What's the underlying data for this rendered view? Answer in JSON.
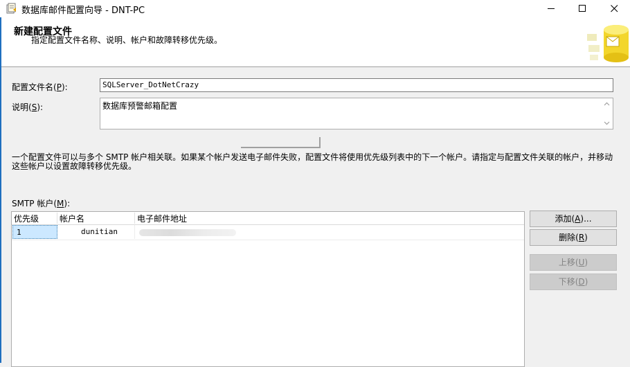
{
  "window": {
    "title": "数据库邮件配置向导 - DNT-PC",
    "minimize_icon": "minimize-icon",
    "maximize_icon": "maximize-icon",
    "close_icon": "close-icon"
  },
  "header": {
    "title": "新建配置文件",
    "subtitle": "指定配置文件名称、说明、帐户和故障转移优先级。",
    "image": "database-mail-icon"
  },
  "form": {
    "profile_name_label_pre": "配置文件名(",
    "profile_name_label_key": "P",
    "profile_name_label_post": "):",
    "profile_name_value": "SQLServer_DotNetCrazy",
    "description_label_pre": "说明(",
    "description_label_key": "S",
    "description_label_post": "):",
    "description_value": "数据库预警邮箱配置"
  },
  "info_text": "一个配置文件可以与多个 SMTP 帐户相关联。如果某个帐户发送电子邮件失败，配置文件将使用优先级列表中的下一个帐户。请指定与配置文件关联的帐户，并移动这些帐户以设置故障转移优先级。",
  "smtp": {
    "label_pre": "SMTP 帐户(",
    "label_key": "M",
    "label_post": "):",
    "columns": [
      "优先级",
      "帐户名",
      "电子邮件地址"
    ],
    "rows": [
      {
        "priority": "1",
        "account": "dunitian",
        "email": ""
      }
    ]
  },
  "buttons": {
    "add_pre": "添加(",
    "add_key": "A",
    "add_post": ")...",
    "remove_pre": "删除(",
    "remove_key": "R",
    "remove_post": ")",
    "up_pre": "上移(",
    "up_key": "U",
    "up_post": ")",
    "down_pre": "下移(",
    "down_key": "D",
    "down_post": ")"
  },
  "colors": {
    "accent": "#1f6fbf",
    "selection": "#cce8ff",
    "background": "#f0f0f0"
  }
}
